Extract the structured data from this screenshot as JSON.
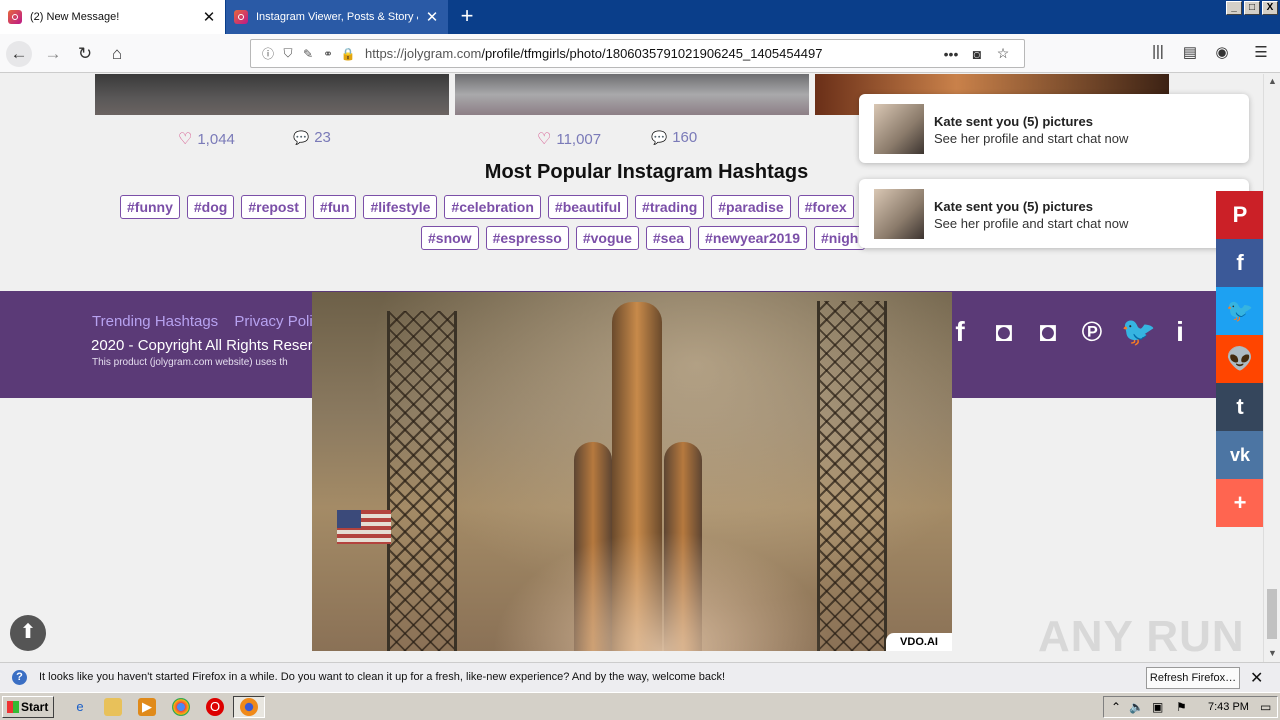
{
  "browser": {
    "tabs": [
      {
        "label": "(2) New Message!",
        "active": true
      },
      {
        "label": "Instagram Viewer, Posts & Story &",
        "active": false
      }
    ],
    "new_tab": "+",
    "url_host": "https://jolygram.com",
    "url_path": "/profile/tfmgirls/photo/1806035791021906245_1405454497",
    "url_more": "•••",
    "window_buttons": {
      "minimize": "_",
      "maximize": "□",
      "close": "X"
    }
  },
  "posts": [
    {
      "likes": "1,044",
      "comments": "23"
    },
    {
      "likes": "11,007",
      "comments": "160"
    }
  ],
  "hashtags": {
    "title": "Most Popular Instagram Hashtags",
    "row1": [
      "#funny",
      "#dog",
      "#repost",
      "#fun",
      "#lifestyle",
      "#celebration",
      "#beautiful",
      "#trading",
      "#paradise",
      "#forex"
    ],
    "row2": [
      "#snow",
      "#espresso",
      "#vogue",
      "#sea",
      "#newyear2019",
      "#nigh"
    ]
  },
  "footer": {
    "links": [
      "Trending Hashtags",
      "Privacy Polic"
    ],
    "copyright": "2020 - Copyright All Rights Reser",
    "disclaimer": "This product (jolygram.com website) uses th"
  },
  "video": {
    "badge": "VDO.AI"
  },
  "notifications": [
    {
      "title": "Kate sent you (5) pictures",
      "text": "See her profile and start chat now"
    },
    {
      "title": "Kate sent you (5) pictures",
      "text": "See her profile and start chat now"
    }
  ],
  "share_buttons": [
    {
      "icon": "pinterest-icon",
      "glyph": "P",
      "color": "#cb2027"
    },
    {
      "icon": "facebook-icon",
      "glyph": "f",
      "color": "#3b5998"
    },
    {
      "icon": "twitter-icon",
      "glyph": "🐦",
      "color": "#1da1f2"
    },
    {
      "icon": "reddit-icon",
      "glyph": "👽",
      "color": "#ff4500"
    },
    {
      "icon": "tumblr-icon",
      "glyph": "t",
      "color": "#35465c"
    },
    {
      "icon": "vk-icon",
      "glyph": "vk",
      "color": "#4c75a3"
    },
    {
      "icon": "more-icon",
      "glyph": "+",
      "color": "#ff6550"
    }
  ],
  "watermark": "ANY RUN",
  "infobar": {
    "text": "It looks like you haven't started Firefox in a while. Do you want to clean it up for a fresh, like-new experience? And by the way, welcome back!",
    "button": "Refresh Firefox…",
    "close": "✕"
  },
  "taskbar": {
    "start": "Start",
    "clock": "7:43 PM"
  }
}
